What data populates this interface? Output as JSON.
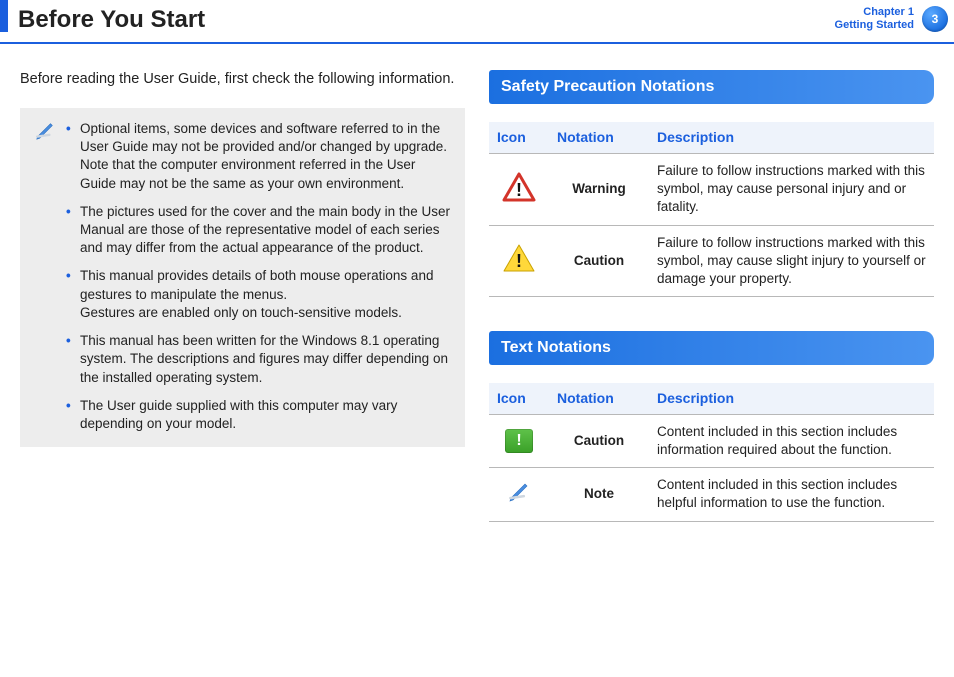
{
  "header": {
    "title": "Before You Start",
    "chapter_line1": "Chapter 1",
    "chapter_line2": "Getting Started",
    "page_number": "3"
  },
  "left": {
    "intro": "Before reading the User Guide, first check the following information.",
    "bullets": [
      {
        "main": "Optional items, some devices and software referred to in the User Guide may not be provided and/or changed by upgrade.",
        "sub": "Note that the computer environment referred in the User Guide may not be the same as your own environment."
      },
      {
        "main": "The pictures used for the cover and the main body in the User Manual are those of the representative model of each series and may differ from the actual appearance of the product.",
        "sub": ""
      },
      {
        "main": "This manual provides details of both mouse operations and gestures to manipulate the menus.",
        "sub": "Gestures are enabled only on touch-sensitive models."
      },
      {
        "main": "This manual has been written for the Windows 8.1 operating system. The descriptions and figures may differ depending on the installed operating system.",
        "sub": ""
      },
      {
        "main": "The User guide supplied with this computer may vary depending on your model.",
        "sub": ""
      }
    ]
  },
  "right": {
    "safety_heading": "Safety Precaution Notations",
    "text_heading": "Text Notations",
    "table_headers": {
      "icon": "Icon",
      "notation": "Notation",
      "description": "Description"
    },
    "safety_rows": [
      {
        "icon_name": "warning-triangle-red",
        "notation": "Warning",
        "notation_class": "notation-warning",
        "description": "Failure to follow instructions marked with this symbol, may cause personal injury and or fatality."
      },
      {
        "icon_name": "caution-triangle-yellow",
        "notation": "Caution",
        "notation_class": "notation-caution-safety",
        "description": "Failure to follow instructions marked with this symbol, may cause slight injury to yourself or damage your property."
      }
    ],
    "text_rows": [
      {
        "icon_name": "caution-green-box",
        "notation": "Caution",
        "notation_class": "notation-caution-text",
        "description": "Content included in this section includes information required about the function."
      },
      {
        "icon_name": "note-pencil-icon",
        "notation": "Note",
        "notation_class": "notation-note",
        "description": "Content included in this section includes helpful information to use the function."
      }
    ]
  }
}
